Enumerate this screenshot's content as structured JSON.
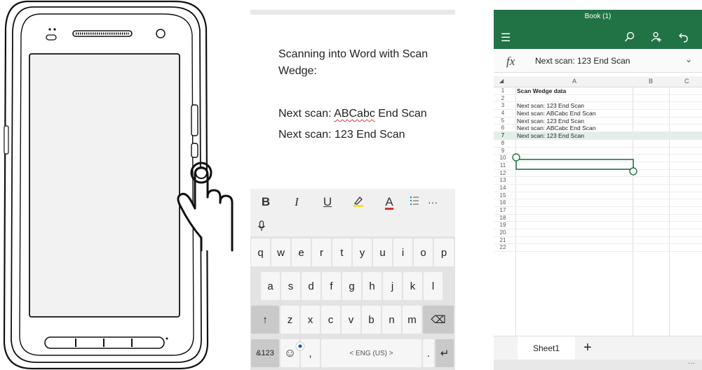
{
  "word": {
    "doc_lines": [
      "Scanning into Word with Scan",
      "Wedge:"
    ],
    "scan1_prefix": "Next scan: ",
    "scan1_word": "ABCabc",
    "scan1_suffix": " End Scan",
    "scan2": "Next scan: 123 End Scan",
    "format_bar": {
      "bold": "B",
      "italic": "I",
      "underline": "U",
      "highlight": "highlight-icon",
      "font_color": "A",
      "list": "list-icon",
      "more": "···"
    },
    "keyboard": {
      "row1": [
        "q",
        "w",
        "e",
        "r",
        "t",
        "y",
        "u",
        "i",
        "o",
        "p"
      ],
      "row2": [
        "a",
        "s",
        "d",
        "f",
        "g",
        "h",
        "j",
        "k",
        "l"
      ],
      "row3": [
        "z",
        "x",
        "c",
        "v",
        "b",
        "n",
        "m"
      ],
      "shift": "↑",
      "backspace": "⌫",
      "numbers": "&123",
      "comma": ",",
      "space": "< ENG (US) >",
      "period": ".",
      "enter": "↵"
    }
  },
  "excel": {
    "title": "Book (1)",
    "fx": "fx",
    "formula_value": "Next scan: 123 End Scan",
    "columns": [
      "A",
      "B",
      "C"
    ],
    "rows": [
      {
        "n": "1",
        "v": "Scan Wedge data",
        "bold": true
      },
      {
        "n": "2",
        "v": ""
      },
      {
        "n": "3",
        "v": "Next scan: 123 End Scan"
      },
      {
        "n": "4",
        "v": "Next scan: ABCabc End Scan"
      },
      {
        "n": "5",
        "v": "Next scan: 123 End Scan"
      },
      {
        "n": "6",
        "v": "Next scan: ABCabc End Scan"
      },
      {
        "n": "7",
        "v": "Next scan: 123 End Scan"
      },
      {
        "n": "8",
        "v": ""
      },
      {
        "n": "9",
        "v": ""
      },
      {
        "n": "10",
        "v": ""
      },
      {
        "n": "11",
        "v": ""
      },
      {
        "n": "12",
        "v": ""
      },
      {
        "n": "13",
        "v": ""
      },
      {
        "n": "14",
        "v": ""
      },
      {
        "n": "15",
        "v": ""
      },
      {
        "n": "16",
        "v": ""
      },
      {
        "n": "17",
        "v": ""
      },
      {
        "n": "18",
        "v": ""
      },
      {
        "n": "19",
        "v": ""
      },
      {
        "n": "20",
        "v": ""
      },
      {
        "n": "21",
        "v": ""
      },
      {
        "n": "22",
        "v": ""
      }
    ],
    "sheet_tab": "Sheet1",
    "add_sheet": "+",
    "status_more": "···",
    "accent": "#217346"
  }
}
